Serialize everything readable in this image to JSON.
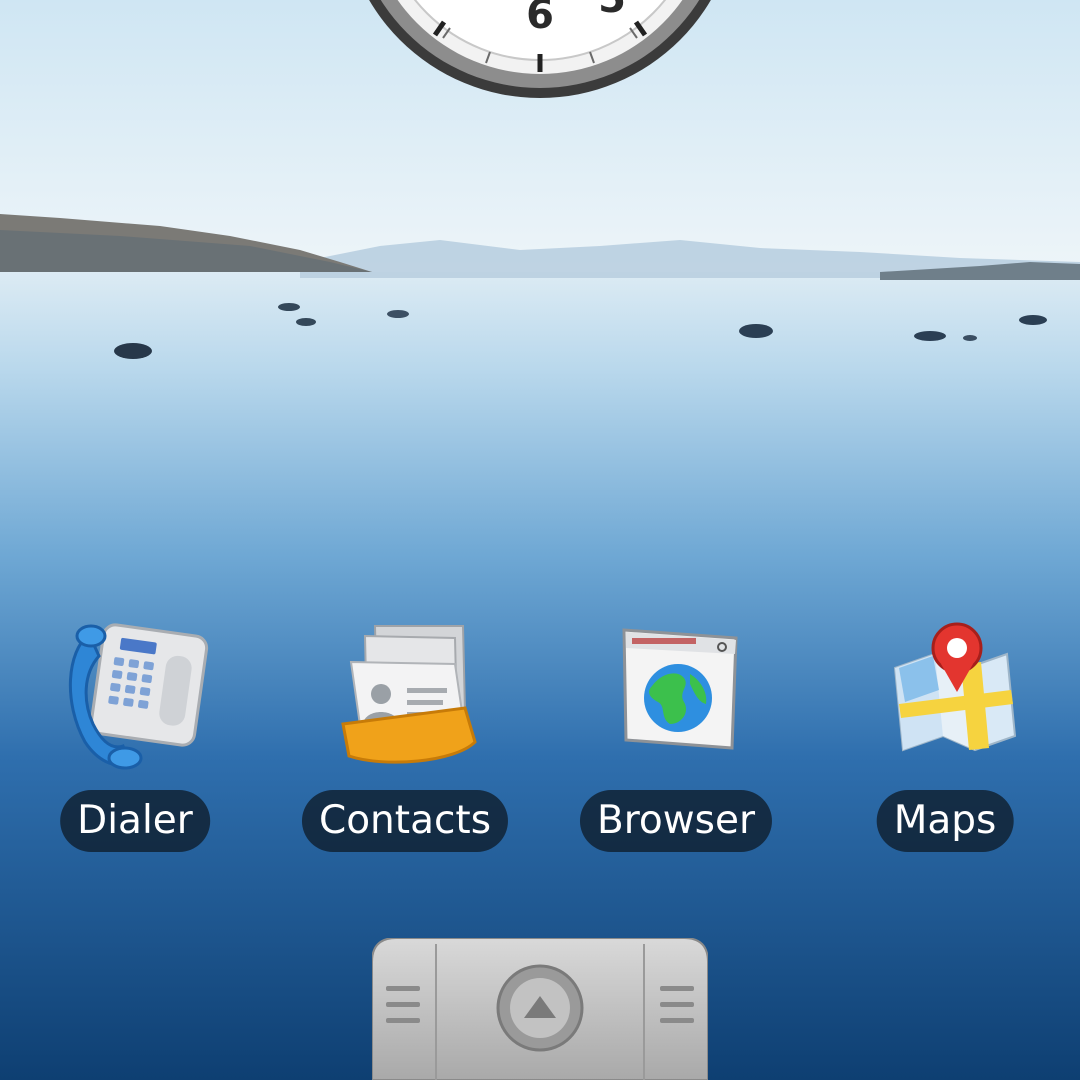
{
  "homescreen": {
    "apps": [
      {
        "label": "Dialer",
        "icon": "dialer-icon"
      },
      {
        "label": "Contacts",
        "icon": "contacts-icon"
      },
      {
        "label": "Browser",
        "icon": "browser-icon"
      },
      {
        "label": "Maps",
        "icon": "maps-icon"
      }
    ],
    "clock": {
      "visible_numerals": [
        "6",
        "5"
      ]
    },
    "drawer": {
      "icon": "chevron-up-icon"
    }
  },
  "colors": {
    "sky_top": "#cfe6f3",
    "sky_horizon": "#e9f3f8",
    "water_light": "#bcdaee",
    "water_mid": "#4f8fc4",
    "water_deep": "#0e3f72",
    "label_bg": "#0f1e2d",
    "label_text": "#ffffff"
  }
}
